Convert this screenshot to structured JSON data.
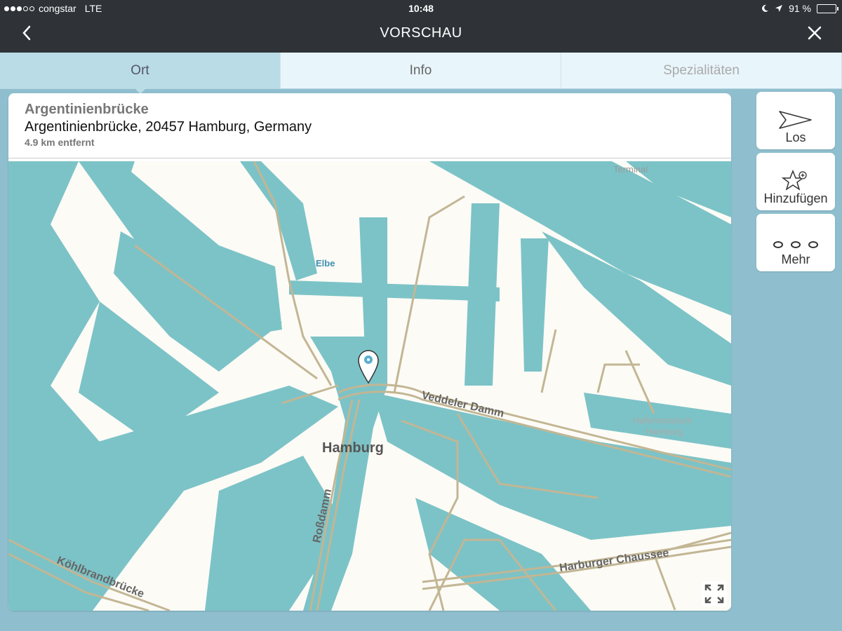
{
  "status_bar": {
    "carrier": "congstar",
    "network": "LTE",
    "time": "10:48",
    "battery": "91 %",
    "battery_level": 0.91
  },
  "nav": {
    "title": "VORSCHAU",
    "back_icon": "chevron-left-icon",
    "close_icon": "close-icon"
  },
  "tabs": [
    {
      "label": "Ort",
      "active": true
    },
    {
      "label": "Info",
      "active": false
    },
    {
      "label": "Spezialitäten",
      "active": false
    }
  ],
  "place": {
    "title": "Argentinienbrücke",
    "address": "Argentinienbrücke, 20457 Hamburg, Germany",
    "distance": "4.9 km entfernt"
  },
  "map": {
    "labels": {
      "terminal": "Terminal",
      "elbe": "Elbe",
      "veddeler": "Veddeler Damm",
      "hafenmuseum_1": "Hafenmuseum",
      "hafenmuseum_2": "Hamburg",
      "hamburg": "Hamburg",
      "rossdamm": "Roßdamm",
      "harburger": "Harburger Chaussee",
      "koehlbrand": "Köhlbrandbrücke"
    },
    "colors": {
      "water": "#7cc3c7",
      "land": "#fdfbf6",
      "road": "#c2b694"
    },
    "fullscreen_icon": "expand-icon"
  },
  "actions": [
    {
      "label": "Los",
      "icon": "send-arrow-icon"
    },
    {
      "label": "Hinzufügen",
      "icon": "star-add-icon"
    },
    {
      "label": "Mehr",
      "icon": "more-dots-icon"
    }
  ]
}
